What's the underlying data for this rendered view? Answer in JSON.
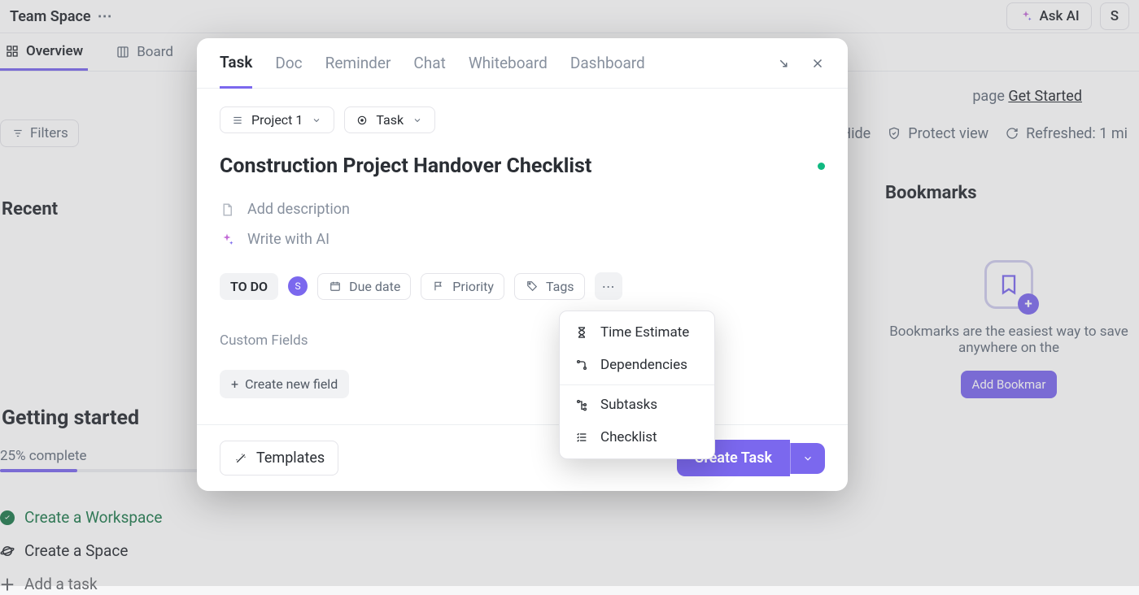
{
  "header": {
    "space_name": "Team Space",
    "ask_ai": "Ask AI",
    "right_letter": "S"
  },
  "view_tabs": {
    "overview": "Overview",
    "board": "Board"
  },
  "banner": {
    "text_prefix": "page ",
    "link": "Get Started"
  },
  "toolbar": {
    "filters": "Filters",
    "hide": "Hide",
    "protect": "Protect view",
    "refreshed": "Refreshed: 1 mi"
  },
  "recent": {
    "title": "Recent"
  },
  "getting_started": {
    "title": "Getting started",
    "percent_label": "25% complete",
    "progress_pct": 25,
    "items": [
      {
        "label": "Create a Workspace",
        "done": true
      },
      {
        "label": "Create a Space",
        "done": false
      },
      {
        "label": "Add a task",
        "done": false
      }
    ]
  },
  "bookmarks": {
    "title": "Bookmarks",
    "desc": "Bookmarks are the easiest way to save anywhere on the",
    "button": "Add Bookmar"
  },
  "modal": {
    "tabs": {
      "task": "Task",
      "doc": "Doc",
      "reminder": "Reminder",
      "chat": "Chat",
      "whiteboard": "Whiteboard",
      "dashboard": "Dashboard"
    },
    "breadcrumb": {
      "project": "Project 1",
      "type": "Task"
    },
    "title": "Construction Project Handover Checklist",
    "description_placeholder": "Add description",
    "ai_label": "Write with AI",
    "status": "TO DO",
    "avatar_initial": "S",
    "due_date": "Due date",
    "priority": "Priority",
    "tags": "Tags",
    "custom_fields_label": "Custom Fields",
    "create_field": "Create new field",
    "templates": "Templates",
    "create_task": "Create Task"
  },
  "dropdown": {
    "time_estimate": "Time Estimate",
    "dependencies": "Dependencies",
    "subtasks": "Subtasks",
    "checklist": "Checklist"
  }
}
